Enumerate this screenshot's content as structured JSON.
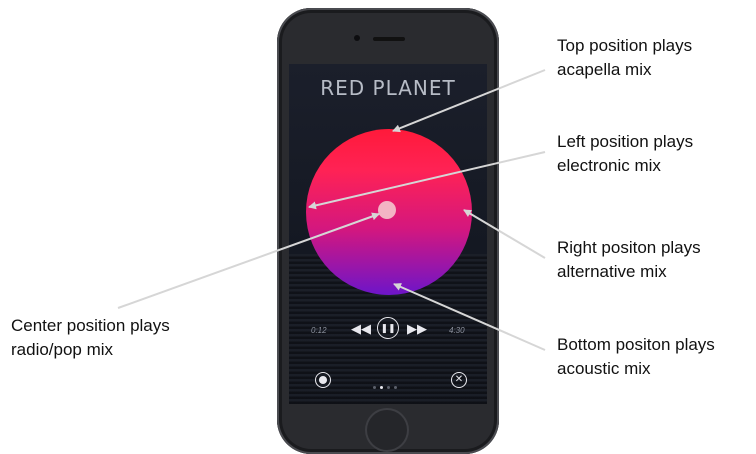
{
  "phone": {
    "title": "RED PLANET",
    "time_elapsed": "0:12",
    "time_remaining": "4:30",
    "controls": {
      "rewind_glyph": "◀◀",
      "pause_glyph": "❚❚",
      "forward_glyph": "▶▶",
      "close_glyph": "✕"
    },
    "page_dots": 4,
    "active_page": 2,
    "colors": {
      "circle_top": "#ff1a3a",
      "circle_bottom": "#6d15c9",
      "center_marker": "#f3b4c4"
    }
  },
  "annotations": {
    "top": [
      "Top position plays",
      "acapella mix"
    ],
    "left": [
      "Left position plays",
      "electronic mix"
    ],
    "right": [
      "Right positon plays",
      "alternative mix"
    ],
    "bottom": [
      "Bottom positon plays",
      "acoustic mix"
    ],
    "center": [
      "Center position plays",
      "radio/pop mix"
    ]
  }
}
